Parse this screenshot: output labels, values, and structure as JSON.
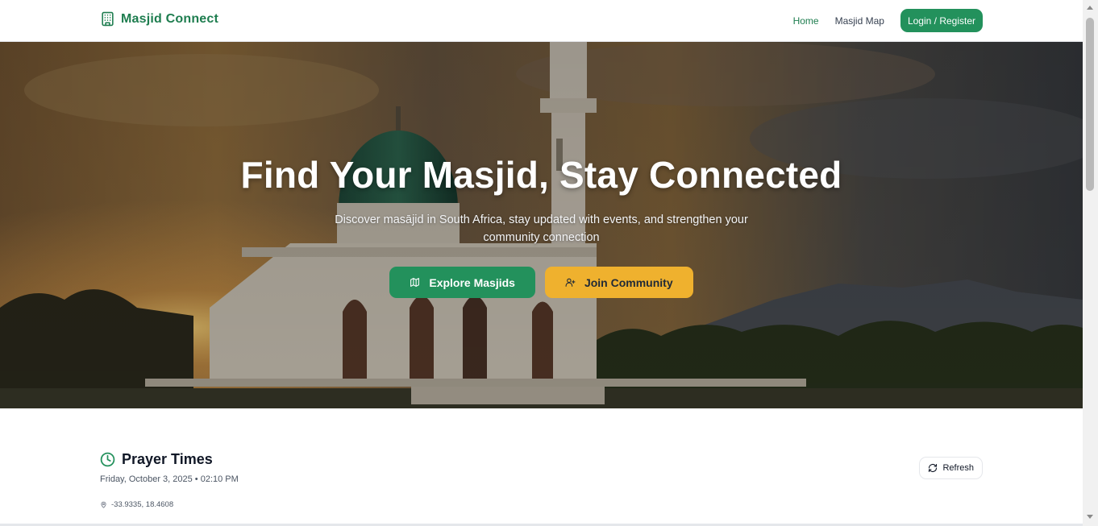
{
  "brand": {
    "name": "Masjid Connect",
    "icon": "building-icon"
  },
  "nav": {
    "home": "Home",
    "map": "Masjid Map",
    "login": "Login / Register"
  },
  "hero": {
    "title": "Find Your Masjid, Stay Connected",
    "subtitle": "Discover masājid in South Africa, stay updated with events, and strengthen your community connection",
    "explore_label": "Explore Masjids",
    "explore_icon": "map-icon",
    "join_label": "Join Community",
    "join_icon": "user-plus-icon"
  },
  "prayer": {
    "title": "Prayer Times",
    "date": "Friday, October 3, 2025 • 02:10 PM",
    "location": "-33.9335, 18.4608",
    "refresh_label": "Refresh"
  },
  "colors": {
    "brand_green": "#1e7d4f",
    "button_green": "#23915c",
    "accent_yellow": "#efb12e"
  }
}
